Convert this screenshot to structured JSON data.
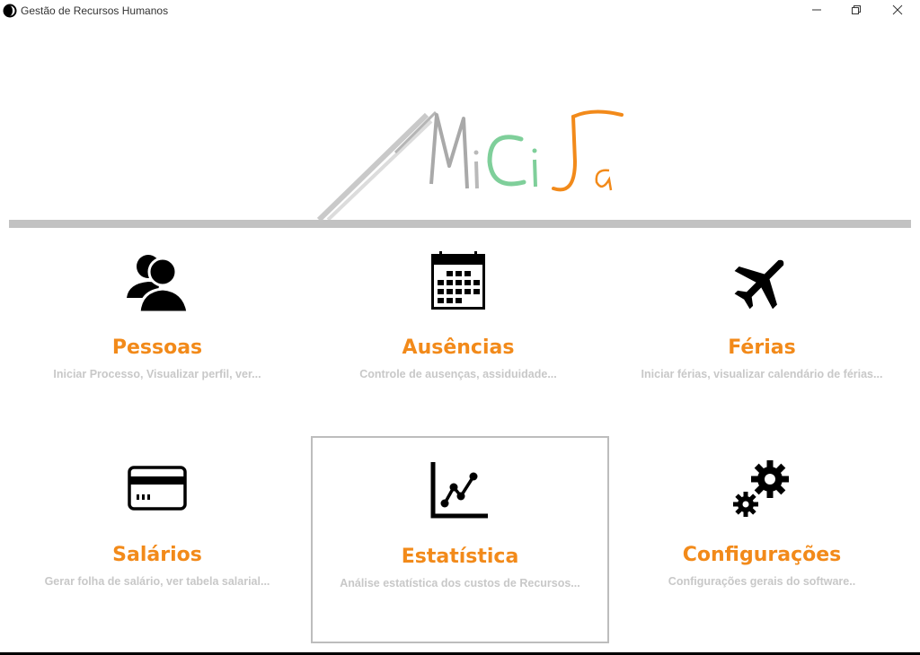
{
  "window": {
    "title": "Gestão de Recursos Humanos"
  },
  "logo": {
    "letters": [
      "M",
      "i",
      "C",
      "i",
      "S",
      "a"
    ]
  },
  "colors": {
    "accent": "#f28a1a",
    "subtitle": "#c8c8c8",
    "logo_green": "#7fcf9a",
    "logo_orange": "#f28a1a"
  },
  "tiles": [
    {
      "title": "Pessoas",
      "description": "Iniciar Processo, Visualizar perfil, ver...",
      "icon": "people-icon"
    },
    {
      "title": "Ausências",
      "description": "Controle de ausenças, assiduidade...",
      "icon": "calendar-icon"
    },
    {
      "title": "Férias",
      "description": "Iniciar férias, visualizar calendário de férias...",
      "icon": "airplane-icon"
    },
    {
      "title": "Salários",
      "description": "Gerar folha de salário, ver tabela salarial...",
      "icon": "credit-card-icon"
    },
    {
      "title": "Estatística",
      "description": "Análise estatística dos custos de Recursos...",
      "icon": "line-chart-icon",
      "selected": true
    },
    {
      "title": "Configurações",
      "description": "Configurações gerais do software..",
      "icon": "gears-icon"
    }
  ]
}
